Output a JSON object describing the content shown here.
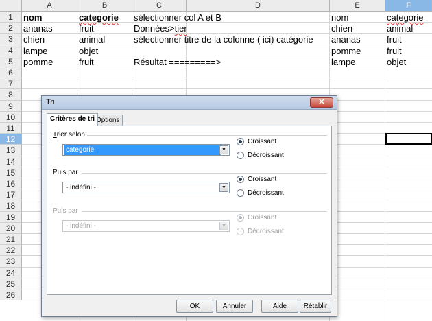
{
  "columns": [
    "A",
    "B",
    "C",
    "D",
    "E",
    "F"
  ],
  "selected_column": "F",
  "rows": [
    "1",
    "2",
    "3",
    "4",
    "5",
    "6",
    "7",
    "8",
    "9",
    "10",
    "11",
    "12",
    "13",
    "14",
    "15",
    "16",
    "17",
    "18",
    "19",
    "20",
    "21",
    "22",
    "23",
    "24",
    "25",
    "26"
  ],
  "selected_row": "12",
  "cells": {
    "A1": "nom",
    "B1": "categorie",
    "C1": "sélectionner col A et B",
    "E1": "nom",
    "F1": "categorie",
    "A2": "ananas",
    "B2": "fruit",
    "C2": "Données>tier",
    "E2": "chien",
    "F2": "animal",
    "A3": "chien",
    "B3": "animal",
    "C3": "sélectionner titre de la colonne ( ici) catégorie",
    "E3": "ananas",
    "F3": "fruit",
    "A4": "lampe",
    "B4": "objet",
    "E4": "pomme",
    "F4": "fruit",
    "A5": "pomme",
    "B5": "fruit",
    "C5": "Résultat =========>",
    "E5": "lampe",
    "F5": "objet"
  },
  "dialog": {
    "title": "Tri",
    "close_label": "✕",
    "tabs": [
      "Critères de tri",
      "Options"
    ],
    "sort_key_1": {
      "label": "Trier selon",
      "value": "categorie",
      "ascending": "Croissant",
      "descending": "Décroissant"
    },
    "sort_key_2": {
      "label": "Puis par",
      "value": "- indéfini -",
      "ascending": "Croissant",
      "descending": "Décroissant"
    },
    "sort_key_3": {
      "label": "Puis par",
      "value": "- indéfini -",
      "ascending": "Croissant",
      "descending": "Décroissant"
    },
    "buttons": {
      "ok": "OK",
      "cancel": "Annuler",
      "help": "Aide",
      "reset": "Rétablir"
    }
  }
}
